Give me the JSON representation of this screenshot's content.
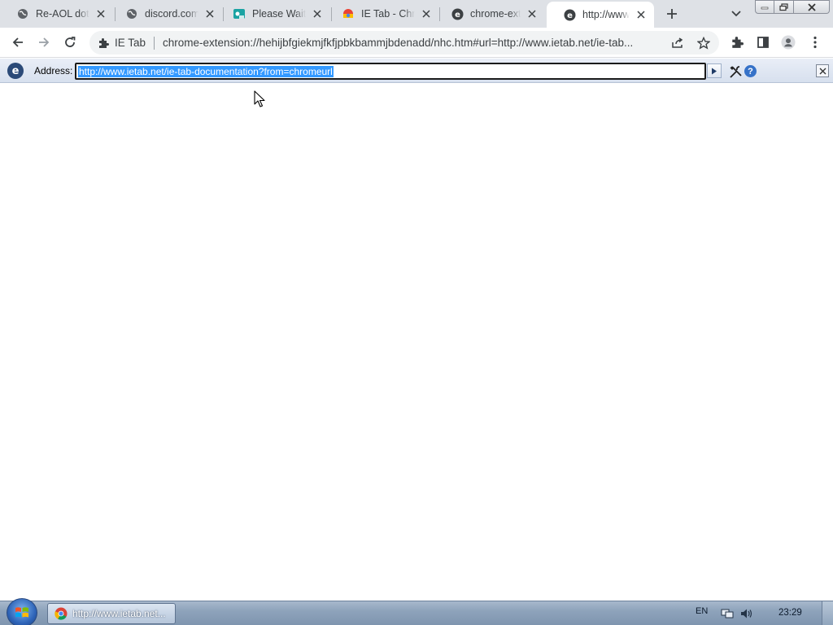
{
  "browser": {
    "tabs": [
      {
        "title": "Re-AOL dot",
        "icon": "globe-icon"
      },
      {
        "title": "discord.com",
        "icon": "globe-icon"
      },
      {
        "title": "Please Wait...",
        "icon": "loading-icon"
      },
      {
        "title": "IE Tab - Chrome",
        "icon": "chrome-webstore-icon"
      },
      {
        "title": "chrome-extension",
        "icon": "ie-icon"
      },
      {
        "title": "http://www.ietab",
        "icon": "ie-icon",
        "active": true
      }
    ],
    "omnibox": {
      "extension_name": "IE Tab",
      "url": "chrome-extension://hehijbfgiekmjfkfjpbkbammjbdenadd/nhc.htm#url=http://www.ietab.net/ie-tab..."
    }
  },
  "ietab": {
    "address_label": "Address:",
    "address_value": "http://www.ietab.net/ie-tab-documentation?from=chromeurl",
    "help_symbol": "?"
  },
  "taskbar": {
    "task_title": "http://www.ietab.net...",
    "language": "EN",
    "clock": "23:29"
  },
  "colors": {
    "tabstrip": "#dee1e6",
    "omnibox": "#f1f3f4",
    "selection": "#3399ff",
    "iebar": "#d7e0ee"
  }
}
